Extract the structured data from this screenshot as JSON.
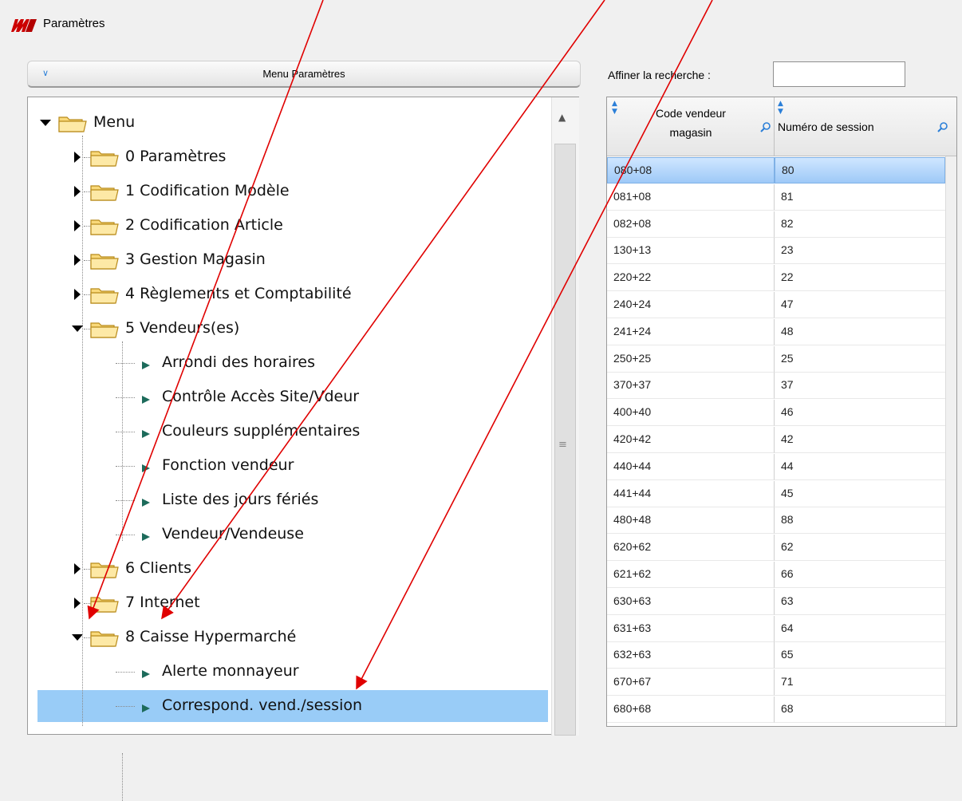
{
  "window": {
    "title": "Paramètres"
  },
  "menu_panel": {
    "header": "Menu Paramètres"
  },
  "tree": {
    "rows": [
      {
        "label": "Menu",
        "kind": "folder",
        "expanded": true,
        "level": 0
      },
      {
        "label": "0 Paramètres",
        "kind": "folder",
        "expanded": false,
        "level": 1
      },
      {
        "label": "1 Codification Modèle",
        "kind": "folder",
        "expanded": false,
        "level": 1
      },
      {
        "label": "2 Codification Article",
        "kind": "folder",
        "expanded": false,
        "level": 1
      },
      {
        "label": "3 Gestion Magasin",
        "kind": "folder",
        "expanded": false,
        "level": 1
      },
      {
        "label": "4 Règlements et Comptabilité",
        "kind": "folder",
        "expanded": false,
        "level": 1
      },
      {
        "label": "5 Vendeurs(es)",
        "kind": "folder",
        "expanded": true,
        "level": 1
      },
      {
        "label": "Arrondi des horaires",
        "kind": "leaf",
        "level": 2
      },
      {
        "label": "Contrôle Accès Site/Vdeur",
        "kind": "leaf",
        "level": 2
      },
      {
        "label": "Couleurs supplémentaires",
        "kind": "leaf",
        "level": 2
      },
      {
        "label": "Fonction vendeur",
        "kind": "leaf",
        "level": 2
      },
      {
        "label": "Liste des jours fériés",
        "kind": "leaf",
        "level": 2
      },
      {
        "label": "Vendeur/Vendeuse",
        "kind": "leaf",
        "level": 2
      },
      {
        "label": "6 Clients",
        "kind": "folder",
        "expanded": false,
        "level": 1
      },
      {
        "label": "7 Internet",
        "kind": "folder",
        "expanded": false,
        "level": 1
      },
      {
        "label": "8 Caisse Hypermarché",
        "kind": "folder",
        "expanded": true,
        "level": 1
      },
      {
        "label": "Alerte monnayeur",
        "kind": "leaf",
        "level": 2
      },
      {
        "label": "Correspond. vend./session",
        "kind": "leaf",
        "level": 2,
        "selected": true
      }
    ]
  },
  "search": {
    "label": "Affiner la recherche :",
    "value": ""
  },
  "grid": {
    "columns": [
      {
        "label_line1": "Code vendeur",
        "label_line2": "magasin"
      },
      {
        "label_line1": "Numéro de session",
        "label_line2": ""
      }
    ],
    "rows": [
      [
        "080+08",
        "80"
      ],
      [
        "081+08",
        "81"
      ],
      [
        "082+08",
        "82"
      ],
      [
        "130+13",
        "23"
      ],
      [
        "220+22",
        "22"
      ],
      [
        "240+24",
        "47"
      ],
      [
        "241+24",
        "48"
      ],
      [
        "250+25",
        "25"
      ],
      [
        "370+37",
        "37"
      ],
      [
        "400+40",
        "46"
      ],
      [
        "420+42",
        "42"
      ],
      [
        "440+44",
        "44"
      ],
      [
        "441+44",
        "45"
      ],
      [
        "480+48",
        "88"
      ],
      [
        "620+62",
        "62"
      ],
      [
        "621+62",
        "66"
      ],
      [
        "630+63",
        "63"
      ],
      [
        "631+63",
        "64"
      ],
      [
        "632+63",
        "65"
      ],
      [
        "670+67",
        "71"
      ],
      [
        "680+68",
        "68"
      ]
    ],
    "selected_row": 0
  },
  "colors": {
    "annotation_arrow": "#e00000",
    "tree_selection": "#99ccf7",
    "logo": "#cc0000"
  },
  "icons": [
    "app-logo-icon",
    "double-chevron-down-icon",
    "folder-icon",
    "triangle-expander-icon",
    "leaf-arrow-icon",
    "sort-arrows-icon",
    "magnifier-icon",
    "scroll-up-arrow-icon",
    "scroll-grip-icon"
  ]
}
